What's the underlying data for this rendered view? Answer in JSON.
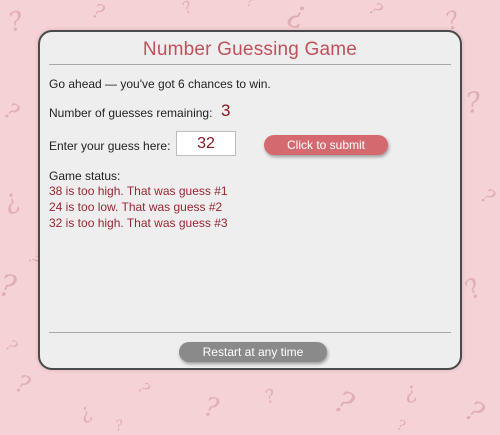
{
  "game": {
    "title": "Number Guessing Game",
    "intro": "Go ahead — you've got 6 chances to win.",
    "remaining_label": "Number of guesses remaining:",
    "remaining_value": "3",
    "guess_label": "Enter your guess here:",
    "guess_value": "32",
    "submit_label": "Click to submit",
    "status_label": "Game status:",
    "status_messages": [
      "38 is too high. That was guess #1",
      "24 is too low. That was guess #2",
      "32 is too high. That was guess #3"
    ],
    "restart_label": "Restart at any time"
  },
  "background": {
    "pattern_icon": "question-mark-icon"
  },
  "colors": {
    "background": "#f5d2d5",
    "pattern": "#e0aeb3",
    "panel": "#eeeeee",
    "title": "#c0505a",
    "accent_dark": "#8b1a24",
    "status_text": "#9b2530",
    "submit_button": "#d46a6f",
    "restart_button": "#8a8a8a"
  }
}
